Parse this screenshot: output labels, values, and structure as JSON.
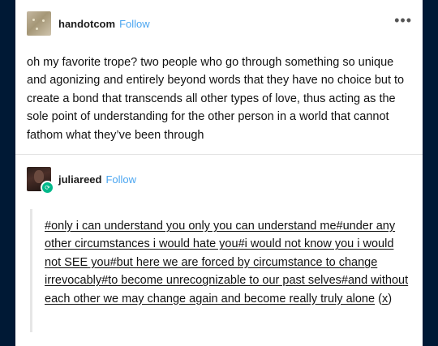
{
  "post": {
    "username": "handotcom",
    "follow_label": "Follow",
    "more_icon": "•••",
    "body": "oh my favorite trope? two people who go through something so unique and agonizing and entirely beyond words that they have no choice but to create a bond that transcends all other types of love, thus acting as the sole point of understanding for the other person in a world that cannot fathom what they’ve been through"
  },
  "reblog": {
    "username": "juliareed",
    "follow_label": "Follow",
    "tags_text": "#only i can understand you only you can understand me#under any other circumstances i would hate you#i would not know you i would not SEE you#but here we are forced by circumstance to change irrevocably#to become unrecognizable to our past selves#and without each other we may change again and become really truly alone",
    "source_open": "(",
    "source_link": "x",
    "source_close": ")"
  },
  "colors": {
    "background": "#001935",
    "follow": "#4aa5f0",
    "reblog_badge": "#00b88a"
  }
}
